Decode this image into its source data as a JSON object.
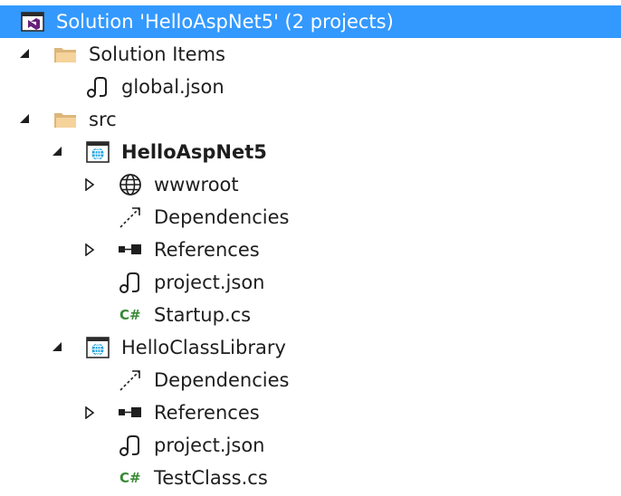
{
  "solution": {
    "label": "Solution 'HelloAspNet5' (2 projects)",
    "icon": "visual-studio-solution-icon"
  },
  "solution_items": {
    "label": "Solution Items",
    "icon": "folder-icon",
    "files": [
      {
        "label": "global.json",
        "icon": "json-file-icon"
      }
    ]
  },
  "src": {
    "label": "src",
    "icon": "folder-icon"
  },
  "projects": [
    {
      "label": "HelloAspNet5",
      "icon": "web-project-icon",
      "children": [
        {
          "label": "wwwroot",
          "icon": "globe-icon"
        },
        {
          "label": "Dependencies",
          "icon": "dependencies-icon"
        },
        {
          "label": "References",
          "icon": "references-icon"
        },
        {
          "label": "project.json",
          "icon": "json-file-icon"
        },
        {
          "label": "Startup.cs",
          "icon": "csharp-file-icon"
        }
      ]
    },
    {
      "label": "HelloClassLibrary",
      "icon": "web-project-icon",
      "children": [
        {
          "label": "Dependencies",
          "icon": "dependencies-icon"
        },
        {
          "label": "References",
          "icon": "references-icon"
        },
        {
          "label": "project.json",
          "icon": "json-file-icon"
        },
        {
          "label": "TestClass.cs",
          "icon": "csharp-file-icon"
        }
      ]
    }
  ],
  "colors": {
    "selection": "#3399ff",
    "folder": "#dcb67a",
    "csharp": "#388a34",
    "web_project": "#1ba1e2",
    "text": "#1e1e1e"
  },
  "glyphs": {
    "csharp": "C#"
  }
}
